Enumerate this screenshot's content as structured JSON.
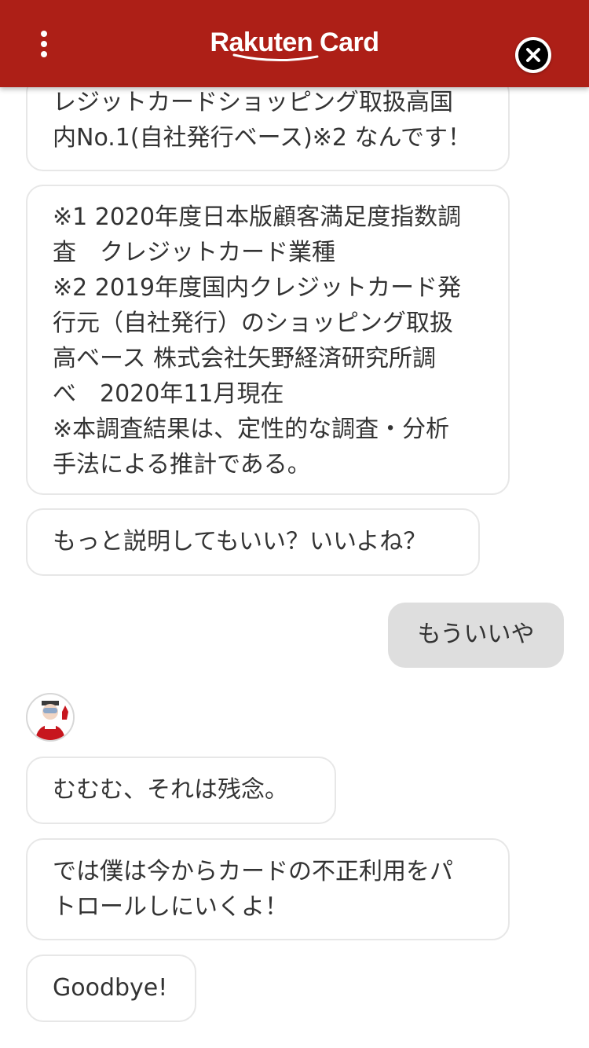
{
  "header": {
    "brand_name": "Rakuten Card",
    "background_color": "#ad1f17"
  },
  "messages": [
    {
      "sender": "bot",
      "text": "レジットカードショッピング取扱高国\n内No.1(自社発行ベース)※2 なんです！"
    },
    {
      "sender": "bot",
      "text": "※1 2020年度日本版顧客満足度指数調\n査　クレジットカード業種\n※2 2019年度国内クレジットカード発\n行元（自社発行）のショッピング取扱\n高ベース 株式会社矢野経済研究所調\nべ　2020年11月現在\n※本調査結果は、定性的な調査・分析\n手法による推計である。"
    },
    {
      "sender": "bot",
      "text": "もっと説明してもいい？いいよね？"
    },
    {
      "sender": "user",
      "text": "もういいや"
    },
    {
      "sender": "bot",
      "text": "むむむ、それは残念。"
    },
    {
      "sender": "bot",
      "text": "では僕は今からカードの不正利用をパ\nトロールしにいくよ！"
    },
    {
      "sender": "bot",
      "text": "Goodbye!"
    }
  ],
  "icons": {
    "menu": "more-vertical-icon",
    "close": "close-icon",
    "avatar": "bot-avatar-icon"
  }
}
